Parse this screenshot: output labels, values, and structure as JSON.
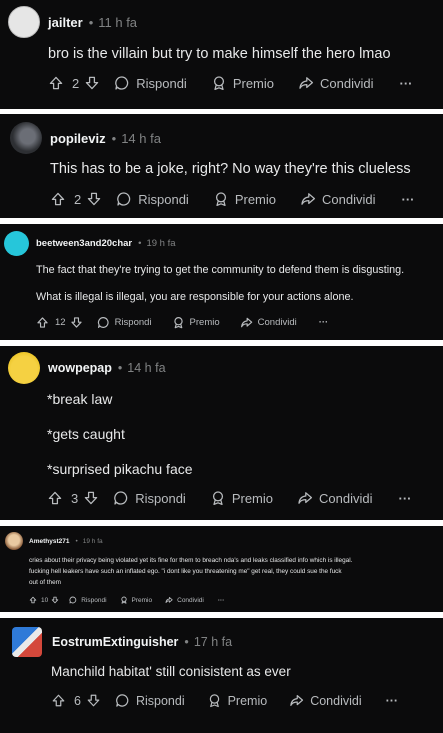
{
  "labels": {
    "reply": "Rispondi",
    "award": "Premio",
    "share": "Condividi",
    "more": "···"
  },
  "icons": [
    "arrow-up-icon",
    "arrow-down-icon",
    "comment-bubble-icon",
    "award-icon",
    "share-arrow-icon"
  ],
  "colors": {
    "card_bg": "#0b0b0c",
    "text": "#e8e9ea",
    "muted": "#818384"
  },
  "comments": [
    {
      "user": "jailter",
      "time": "11 h fa",
      "votes": "2",
      "lines": [
        "bro is the villain but try to make himself the hero lmao"
      ]
    },
    {
      "user": "popileviz",
      "time": "14 h fa",
      "votes": "2",
      "lines": [
        "This has to be a joke, right? No way they're this clueless"
      ]
    },
    {
      "user": "beetween3and20char",
      "time": "19 h fa",
      "votes": "12",
      "lines": [
        "The fact that they're trying to get the community to defend them is disgusting.",
        "What is illegal is illegal, you are responsible for your actions alone."
      ]
    },
    {
      "user": "wowpepap",
      "time": "14 h fa",
      "votes": "3",
      "lines": [
        "*break law",
        "*gets caught",
        "*surprised pikachu face"
      ]
    },
    {
      "user": "Amethyst271",
      "time": "19 h fa",
      "votes": "10",
      "lines": [
        "cries about their privacy being violated yet its fine for them to breach nda's and leaks classified info which is illegal.",
        "fucking hell leakers have such an inflated ego. \"i dont like you threatening me\" get real, they could sue the fuck",
        "out of them"
      ]
    },
    {
      "user": "EostrumExtinguisher",
      "time": "17 h fa",
      "votes": "6",
      "lines": [
        "Manchild habitat' still conisistent as ever"
      ]
    }
  ]
}
